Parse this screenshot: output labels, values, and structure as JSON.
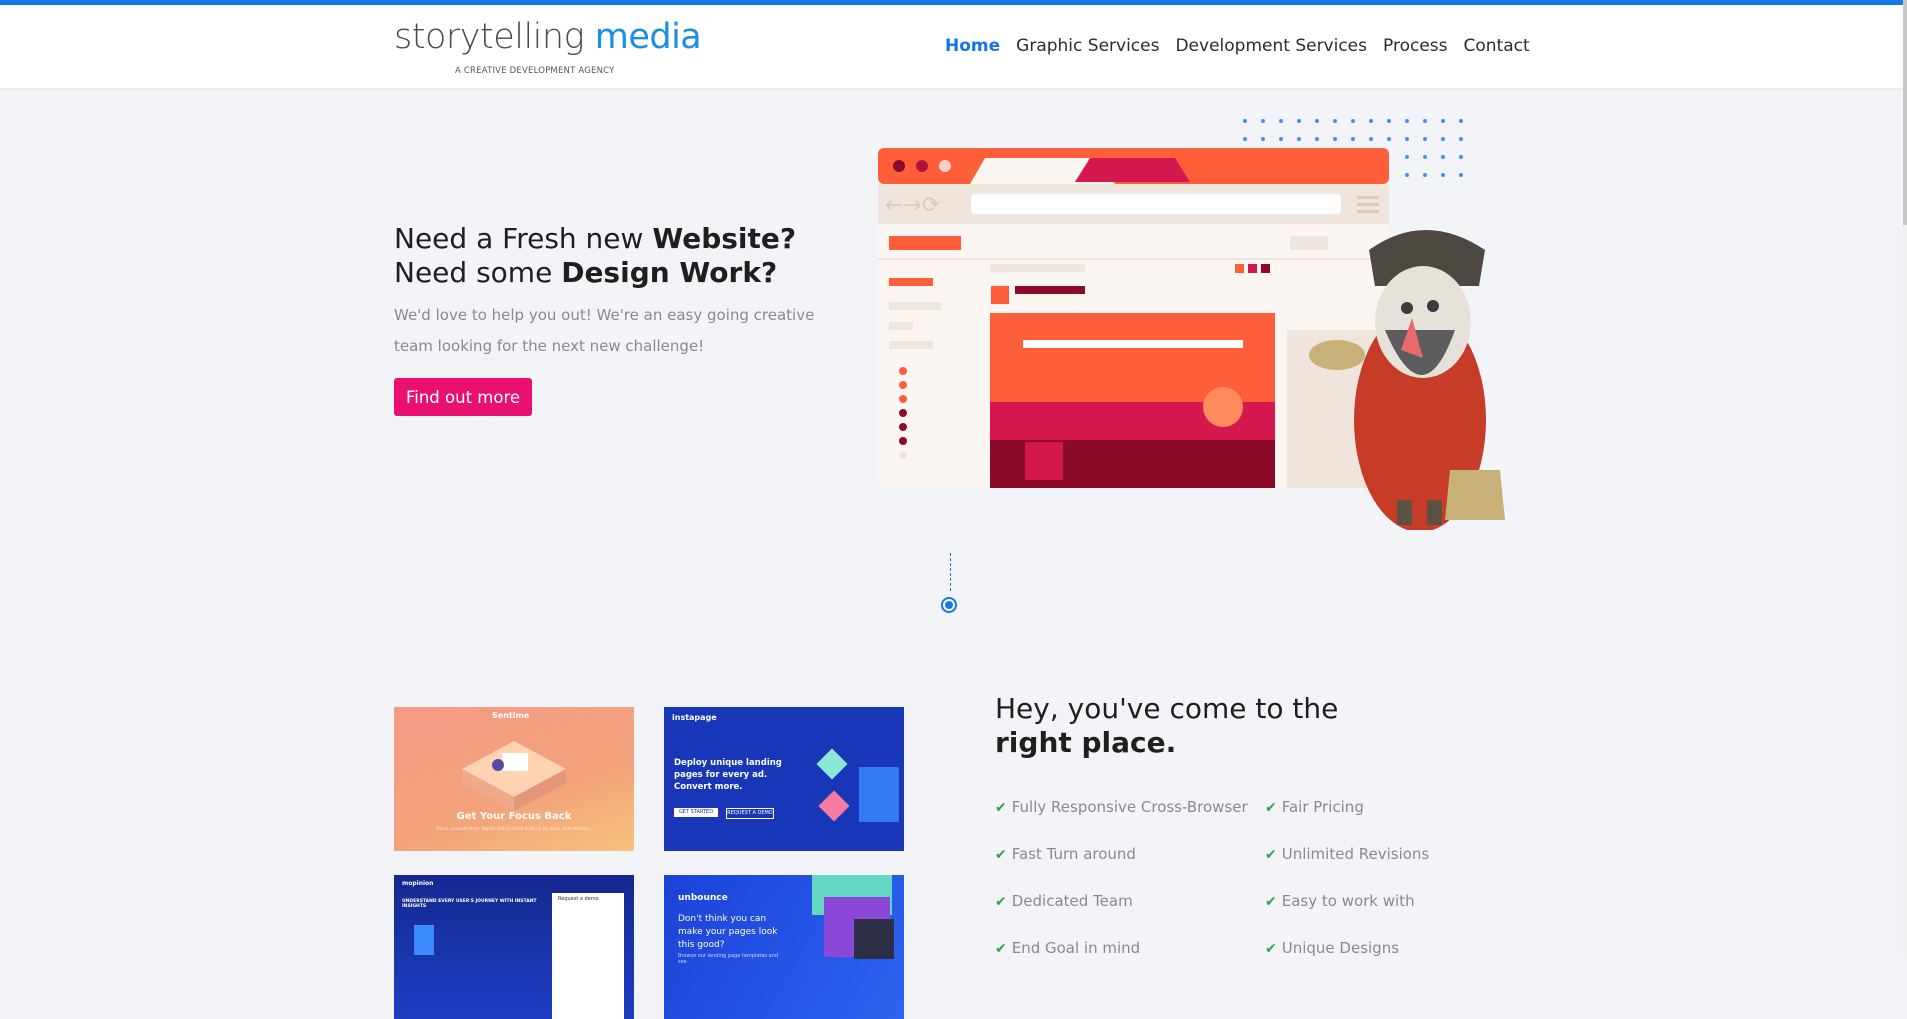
{
  "brand": {
    "logo_main": "storytelling",
    "logo_accent": "media",
    "tagline": "A CREATIVE DEVELOPMENT AGENCY",
    "accent_color": "#1477e8",
    "cta_color": "#ea1070"
  },
  "nav": {
    "items": [
      {
        "label": "Home",
        "active": true
      },
      {
        "label": "Graphic Services",
        "active": false
      },
      {
        "label": "Development Services",
        "active": false
      },
      {
        "label": "Process",
        "active": false
      },
      {
        "label": "Contact",
        "active": false
      }
    ]
  },
  "hero": {
    "line1_prefix": "Need a Fresh new ",
    "line1_bold": "Website?",
    "line2_prefix": "Need some ",
    "line2_bold": "Design Work?",
    "text": "We'd love to help you out! We're an easy going creative team looking for the next new challenge!",
    "cta_label": "Find out more"
  },
  "thumbnails": [
    {
      "brand": "Sentime",
      "headline": "Get Your Focus Back",
      "subtext": "Block yourself from digital distractions & focus on work that matters."
    },
    {
      "brand": "instapage",
      "headline": "Deploy unique landing pages for every ad. Convert more.",
      "btn1": "GET STARTED",
      "btn2": "REQUEST A DEMO"
    },
    {
      "brand": "mopinion",
      "headline": "UNDERSTAND EVERY USER'S JOURNEY WITH INSTANT INSIGHTS",
      "form_label": "Request a demo"
    },
    {
      "brand": "unbounce",
      "headline": "Don't think you can make your pages look this good?",
      "subtext": "Browse our landing page templates and see"
    }
  ],
  "place": {
    "title_prefix": "Hey, you've come to the",
    "title_bold": "right place.",
    "features": [
      "Fully Responsive Cross-Browser",
      "Fair Pricing",
      "Fast Turn around",
      "Unlimited Revisions",
      "Dedicated Team",
      "Easy to work with",
      "End Goal in mind",
      "Unique Designs"
    ]
  }
}
